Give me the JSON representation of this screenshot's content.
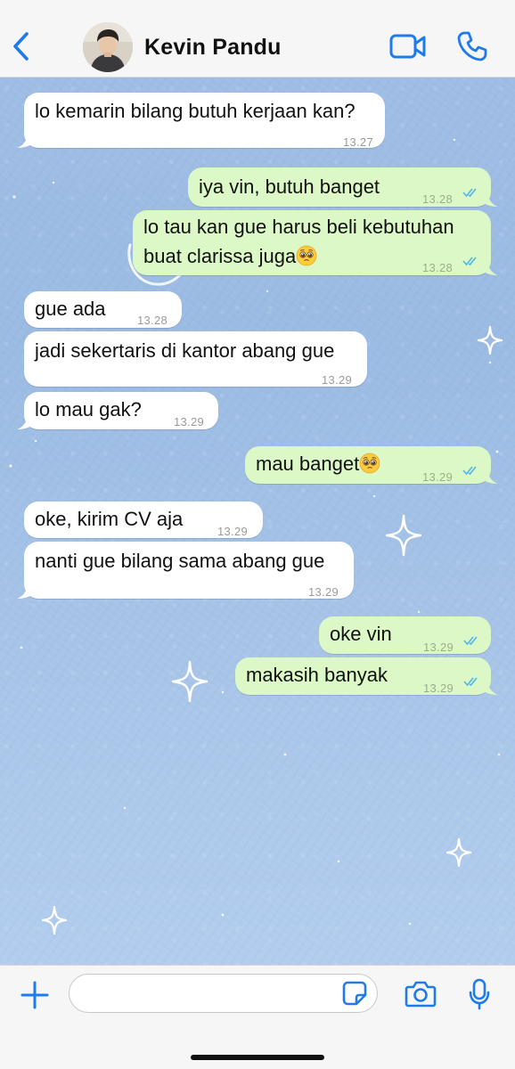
{
  "header": {
    "contact_name": "Kevin Pandu",
    "back_icon": "chevron-left-icon",
    "video_icon": "video-camera-icon",
    "call_icon": "phone-icon"
  },
  "colors": {
    "accent": "#1f7aec",
    "incoming_bubble": "#ffffff",
    "outgoing_bubble": "#dcf8c6",
    "read_ticks": "#4fb6ec",
    "wallpaper": "#a2bfe5"
  },
  "messages": [
    {
      "direction": "in",
      "text": "lo kemarin bilang butuh kerjaan kan?",
      "time": "13.27"
    },
    {
      "direction": "out",
      "text": "iya vin, butuh banget",
      "time": "13.28",
      "status": "read"
    },
    {
      "direction": "out",
      "line1": "lo tau kan gue harus beli kebutuhan",
      "line2": "buat clarissa juga",
      "emoji": "pleading-face-emoji",
      "time": "13.28",
      "status": "read"
    },
    {
      "direction": "in",
      "text": "gue ada",
      "time": "13.28"
    },
    {
      "direction": "in",
      "text": "jadi sekertaris di kantor abang gue",
      "time": "13.29"
    },
    {
      "direction": "in",
      "text": "lo mau gak?",
      "time": "13.29"
    },
    {
      "direction": "out",
      "text": "mau banget",
      "emoji": "pleading-face-emoji",
      "time": "13.29",
      "status": "read"
    },
    {
      "direction": "in",
      "text": "oke, kirim CV aja",
      "time": "13.29"
    },
    {
      "direction": "in",
      "text": "nanti gue bilang sama abang gue",
      "time": "13.29"
    },
    {
      "direction": "out",
      "text": "oke vin",
      "time": "13.29",
      "status": "read"
    },
    {
      "direction": "out",
      "text": "makasih banyak",
      "time": "13.29",
      "status": "read"
    }
  ],
  "input_bar": {
    "placeholder": "",
    "plus_icon": "plus-icon",
    "sticker_icon": "sticker-icon",
    "camera_icon": "camera-icon",
    "mic_icon": "microphone-icon"
  }
}
